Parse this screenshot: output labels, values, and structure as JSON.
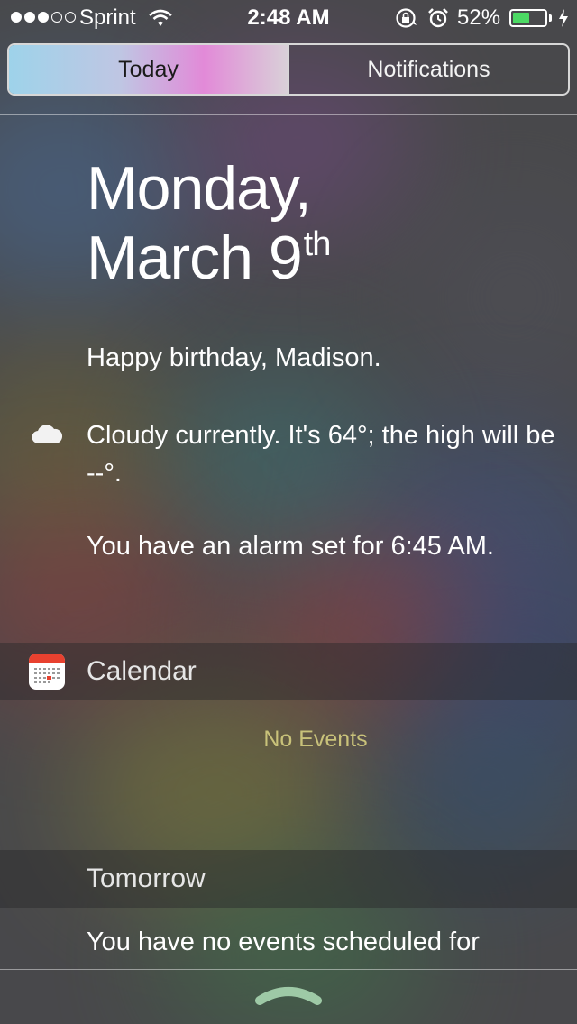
{
  "status_bar": {
    "carrier": "Sprint",
    "time": "2:48 AM",
    "battery_percent": "52%",
    "battery_level": 0.52,
    "signal_bars_filled": 3,
    "signal_bars_total": 5,
    "battery_color": "#4cd964"
  },
  "tabs": {
    "today": "Today",
    "notifications": "Notifications",
    "selected": "today"
  },
  "today": {
    "date_line1": "Monday,",
    "date_line2": "March 9",
    "date_suffix": "th",
    "birthday": "Happy birthday, Madison.",
    "weather": "Cloudy currently. It's 64°; the high will be --°.",
    "weather_icon": "cloud-icon",
    "alarm": "You have an alarm set for 6:45 AM."
  },
  "calendar": {
    "title": "Calendar",
    "icon": "calendar-icon",
    "no_events": "No Events"
  },
  "tomorrow": {
    "title": "Tomorrow",
    "text": "You have no events scheduled for"
  },
  "colors": {
    "accent_no_events": "#c9c27a",
    "calendar_red": "#e8412f"
  }
}
